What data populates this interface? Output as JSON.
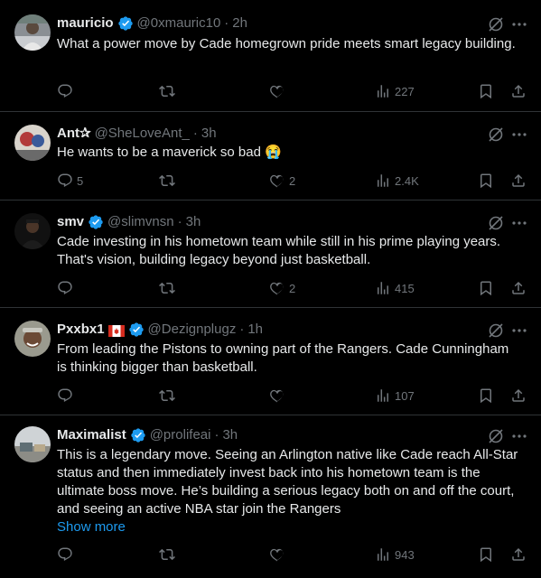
{
  "colors": {
    "accent": "#1d9bf0",
    "muted": "#71767b",
    "text": "#e7e9ea",
    "border": "#2f3336"
  },
  "tweets": [
    {
      "name": "mauricio",
      "handle": "@0xmauric10",
      "dot": "·",
      "time": "2h",
      "text": "What a power move by Cade homegrown pride meets smart legacy building.",
      "replies": "",
      "reposts": "",
      "likes": "",
      "views": "227"
    },
    {
      "name": "Ant✰",
      "handle": "@SheLoveAnt_",
      "dot": "·",
      "time": "3h",
      "text": "He wants to be a maverick so bad 😭",
      "replies": "5",
      "reposts": "",
      "likes": "2",
      "views": "2.4K"
    },
    {
      "name": "smv",
      "handle": "@slimvnsn",
      "dot": "·",
      "time": "3h",
      "text": "Cade investing in his hometown team while still in his prime playing years. That's vision, building legacy beyond just basketball.",
      "replies": "",
      "reposts": "",
      "likes": "2",
      "views": "415"
    },
    {
      "name": "Pxxbx1",
      "handle": "@Dezignplugz",
      "dot": "·",
      "time": "1h",
      "text": "From leading the Pistons to owning part of the Rangers. Cade Cunningham is thinking bigger than basketball.",
      "replies": "",
      "reposts": "",
      "likes": "",
      "views": "107"
    },
    {
      "name": "Maximalist",
      "handle": "@prolifeai",
      "dot": "·",
      "time": "3h",
      "text": "This is a legendary move. Seeing an Arlington native like Cade reach All-Star status and then immediately invest back into his hometown team is the ultimate boss move. He’s building a serious legacy both on and off the court, and seeing an active NBA star join the Rangers",
      "show_more": "Show more",
      "replies": "",
      "reposts": "",
      "likes": "",
      "views": "943"
    }
  ]
}
